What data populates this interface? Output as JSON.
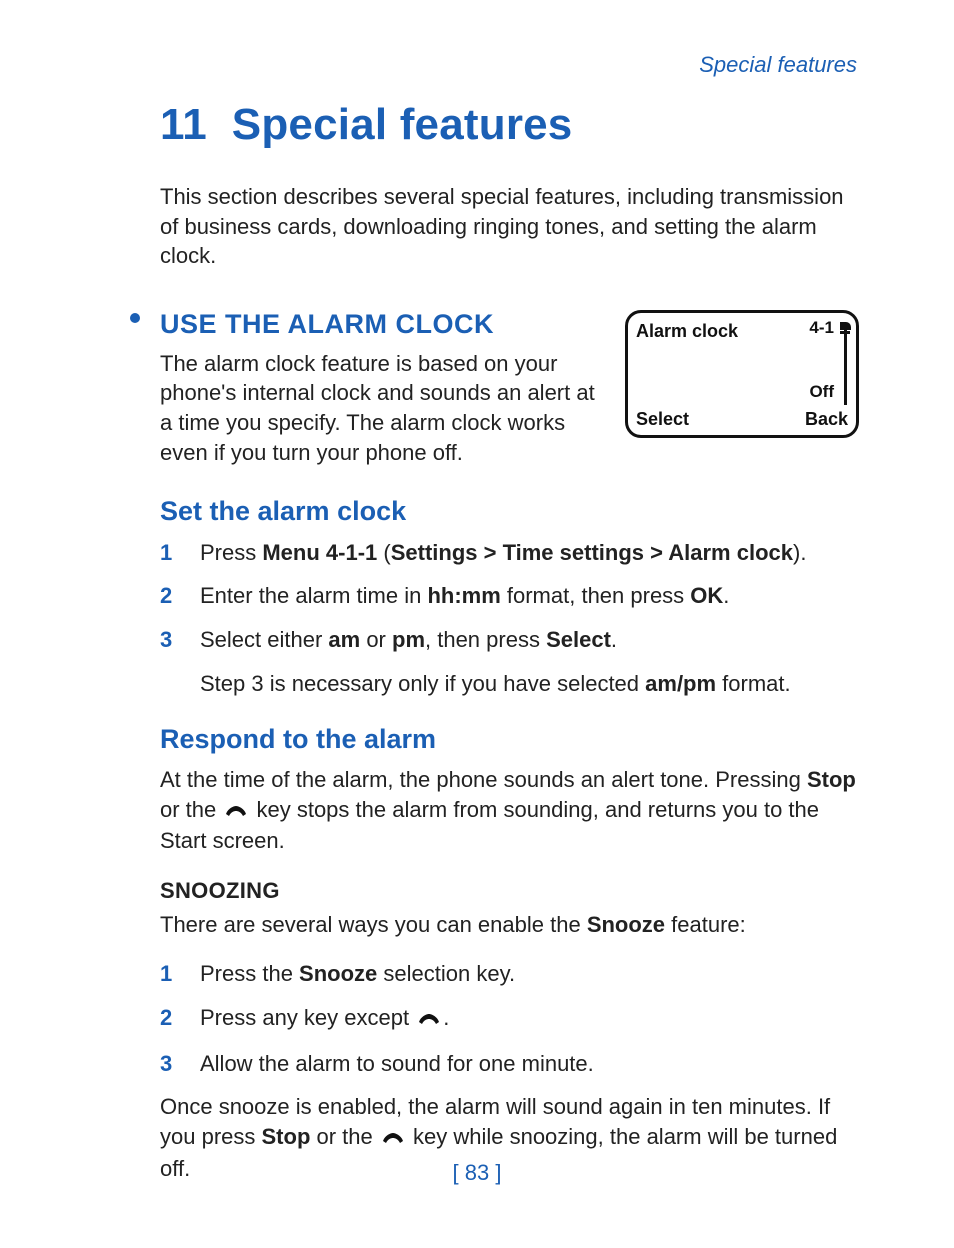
{
  "header": {
    "running": "Special features"
  },
  "chapter": {
    "num": "11",
    "title": "Special features"
  },
  "intro": "This section describes several special features, including transmission of business cards, downloading ringing tones, and setting the alarm clock.",
  "section_use_alarm": {
    "heading": "USE THE ALARM CLOCK",
    "body": "The alarm clock feature is based on your phone's internal clock and sounds an alert at a time you specify. The alarm clock works even if you turn your phone off."
  },
  "screen": {
    "title": "Alarm clock",
    "index": "4-1",
    "status": "Off",
    "softkey_left": "Select",
    "softkey_right": "Back"
  },
  "set_alarm": {
    "heading": "Set the alarm clock",
    "steps": [
      {
        "pre": "Press ",
        "b1": "Menu 4-1-1",
        "mid1": " (",
        "b2": "Settings > Time settings > Alarm clock",
        "post": ")."
      },
      {
        "pre": "Enter the alarm time in ",
        "b1": "hh:mm",
        "mid1": " format, then press ",
        "b2": "OK",
        "post": "."
      },
      {
        "pre": "Select either ",
        "b1": "am",
        "mid1": " or ",
        "b2": "pm",
        "mid2": ", then press ",
        "b3": "Select",
        "post": "."
      }
    ],
    "note": {
      "pre": "Step 3 is necessary only if you have selected ",
      "b1": "am/pm",
      "post": " format."
    }
  },
  "respond": {
    "heading": "Respond to the alarm",
    "body": {
      "pre": "At the time of the alarm, the phone sounds an alert tone. Pressing ",
      "b1": "Stop",
      "mid1": " or the ",
      "post": " key stops the alarm from sounding, and returns you to the Start screen."
    }
  },
  "snoozing": {
    "heading": "SNOOZING",
    "intro": {
      "pre": "There are several ways you can enable the ",
      "b1": "Snooze",
      "post": " feature:"
    },
    "steps": [
      {
        "pre": "Press the ",
        "b1": "Snooze",
        "post": " selection key."
      },
      {
        "type": "endkey",
        "pre": "Press any key except ",
        "post": "."
      },
      {
        "pre": "Allow the alarm to sound for one minute."
      }
    ],
    "after": {
      "pre": "Once snooze is enabled, the alarm will sound again in ten minutes. If you press ",
      "b1": "Stop",
      "mid1": " or the ",
      "post": " key while snoozing, the alarm will be turned off."
    }
  },
  "footer": {
    "page": "[ 83 ]"
  }
}
